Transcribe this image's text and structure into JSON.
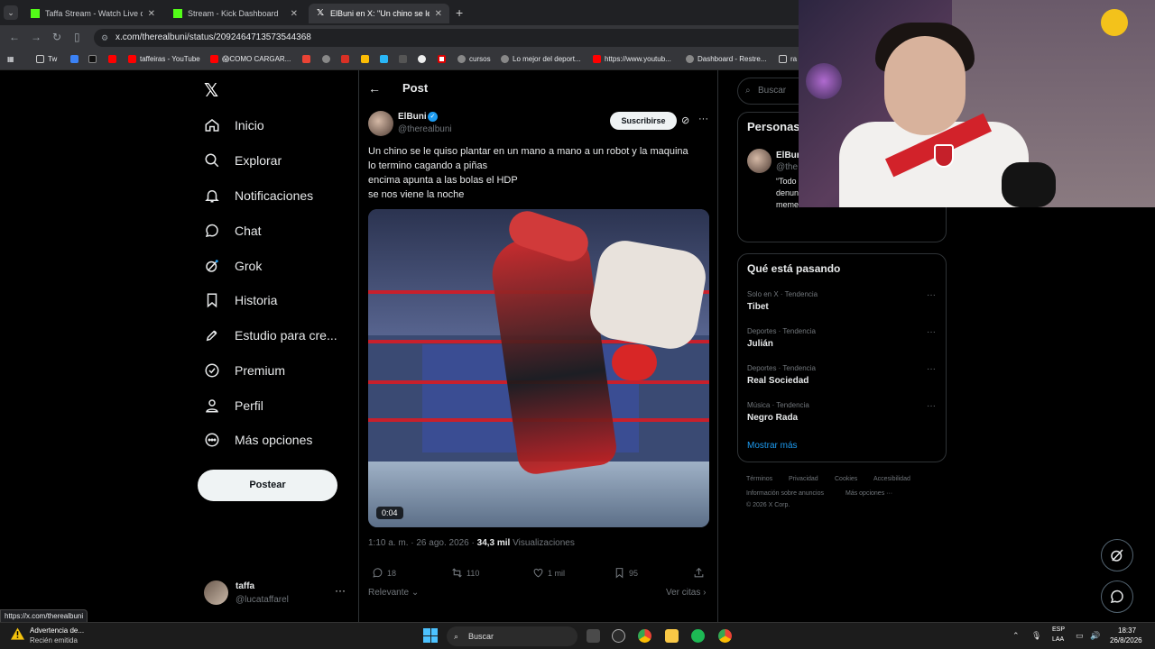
{
  "browser": {
    "tabs": [
      {
        "title": "Taffa Stream - Watch Live o",
        "active": false
      },
      {
        "title": "Stream - Kick Dashboard",
        "active": false
      },
      {
        "title": "ElBuni en X: \"Un chino se le qui",
        "active": true
      }
    ],
    "url": "x.com/therealbuni/status/2092464713573544368",
    "bookmarks": [
      "Tw",
      "taffeiras - YouTube",
      "😱COMO CARGAR...",
      "cursos",
      "Lo mejor del deport...",
      "https://www.youtub...",
      "Dashboard - Restre...",
      "ra"
    ],
    "status_url": "https://x.com/therealbuni"
  },
  "x": {
    "nav": [
      {
        "label": "Inicio",
        "icon": "home-icon"
      },
      {
        "label": "Explorar",
        "icon": "search-icon"
      },
      {
        "label": "Notificaciones",
        "icon": "bell-icon"
      },
      {
        "label": "Chat",
        "icon": "chat-icon"
      },
      {
        "label": "Grok",
        "icon": "grok-icon"
      },
      {
        "label": "Historia",
        "icon": "bookmark-icon"
      },
      {
        "label": "Estudio para cre...",
        "icon": "rocket-icon"
      },
      {
        "label": "Premium",
        "icon": "verified-icon"
      },
      {
        "label": "Perfil",
        "icon": "person-icon"
      },
      {
        "label": "Más opciones",
        "icon": "more-circle-icon"
      }
    ],
    "post_button": "Postear",
    "account": {
      "name": "taffa",
      "handle": "@lucataffarel"
    },
    "post": {
      "header": "Post",
      "author_name": "ElBuni",
      "author_handle": "@therealbuni",
      "subscribe_label": "Suscribirse",
      "text_lines": [
        "Un chino se le quiso plantar en un mano a mano a un robot y la maquina",
        "lo termino cagando a piñas",
        "encima apunta a las bolas el HDP",
        "se nos viene la noche"
      ],
      "video_time": "0:04",
      "time": "1:10 a. m.",
      "date": "26 ago. 2026",
      "views_count": "34,3 mil",
      "views_label": "Visualizaciones",
      "replies": "18",
      "reposts": "110",
      "likes": "1 mil",
      "bookmarks": "95",
      "relevant_label": "Relevante",
      "view_quotes_label": "Ver citas"
    },
    "right": {
      "search_placeholder": "Buscar",
      "people_title": "Personas",
      "person_name": "ElBuni",
      "person_handle": "@the",
      "person_bio": "“Todo occid planeo - la jefa de la zona me denunció por hacerlo perder al marido con memes",
      "trends_title": "Qué está pasando",
      "trends": [
        {
          "context": "Solo en X · Tendencia",
          "name": "Tibet"
        },
        {
          "context": "Deportes · Tendencia",
          "name": "Julián"
        },
        {
          "context": "Deportes · Tendencia",
          "name": "Real Sociedad"
        },
        {
          "context": "Música · Tendencia",
          "name": "Negro Rada"
        }
      ],
      "show_more": "Mostrar más",
      "footer": {
        "terms": "Términos",
        "privacy": "Privacidad",
        "cookies": "Cookies",
        "accessibility": "Accesibilidad",
        "ads": "Información sobre anuncios",
        "more": "Más opciones ···",
        "copyright": "© 2026 X Corp."
      }
    }
  },
  "taskbar": {
    "warning_title": "Advertencia de...",
    "warning_sub": "Recién emitida",
    "search_label": "Buscar",
    "lang1": "ESP",
    "lang2": "LAA",
    "time": "18:37",
    "date": "26/8/2026"
  }
}
